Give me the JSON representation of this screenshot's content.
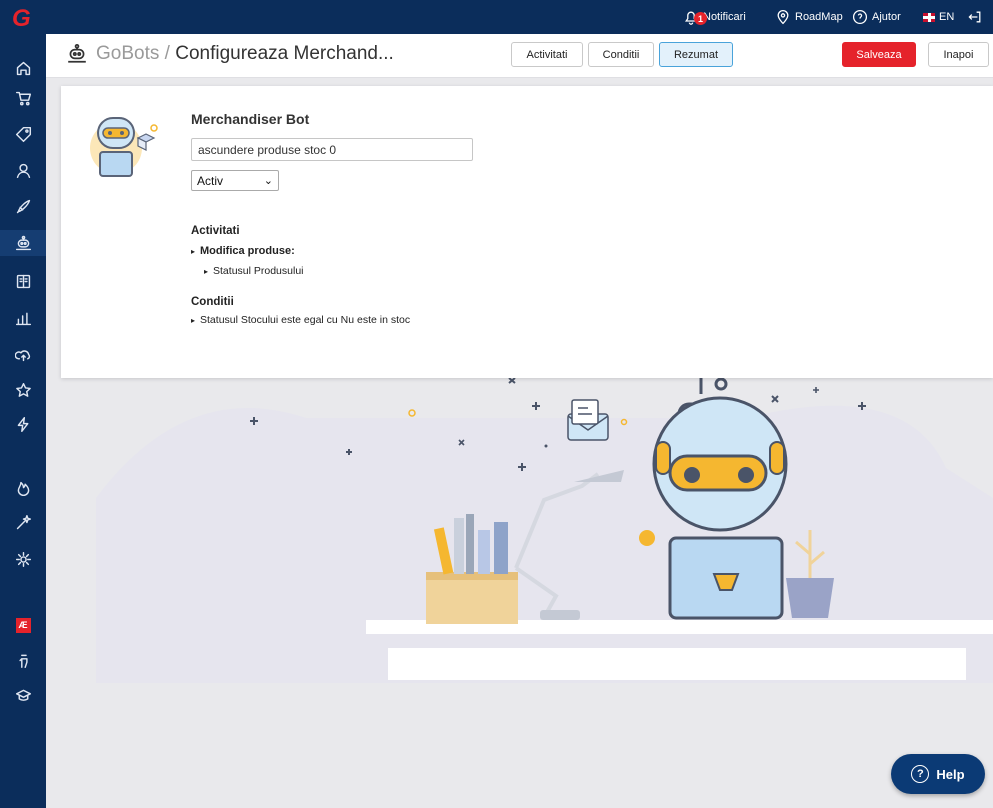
{
  "topbar": {
    "notifications_label": "Notificari",
    "notifications_count": "1",
    "roadmap_label": "RoadMap",
    "help_label": "Ajutor",
    "language_label": "EN"
  },
  "header": {
    "breadcrumb_root": "GoBots",
    "separator": " / ",
    "current": "Configureaza Merchand...",
    "tabs": [
      {
        "label": "Activitati",
        "selected": false
      },
      {
        "label": "Conditii",
        "selected": false
      },
      {
        "label": "Rezumat",
        "selected": true
      }
    ],
    "save_label": "Salveaza",
    "back_label": "Inapoi"
  },
  "bot": {
    "title": "Merchandiser Bot",
    "name_value": "ascundere produse stoc 0",
    "status_value": "Activ"
  },
  "summary": {
    "activities_heading": "Activitati",
    "activity_group": "Modifica produse:",
    "activity_item": "Statusul Produsului",
    "conditions_heading": "Conditii",
    "condition_item": "Statusul Stocului este egal cu Nu este in stoc",
    "bullet": "▸"
  },
  "help_button": {
    "label": "Help"
  },
  "colors": {
    "brand_navy": "#0b2d5b",
    "accent_red": "#e5232b",
    "selected_tab_bg": "#e3f1fb",
    "help_bg": "#0b3a75"
  },
  "sidebar_icons": [
    "home-icon",
    "cart-icon",
    "tag-icon",
    "customers-icon",
    "rocket-icon",
    "gobots-icon",
    "catalog-icon",
    "reports-icon",
    "cloud-icon",
    "star-icon",
    "bolt-icon",
    "fire-icon",
    "magic-icon",
    "settings-icon",
    "ae-icon",
    "hand-icon",
    "academy-icon"
  ]
}
